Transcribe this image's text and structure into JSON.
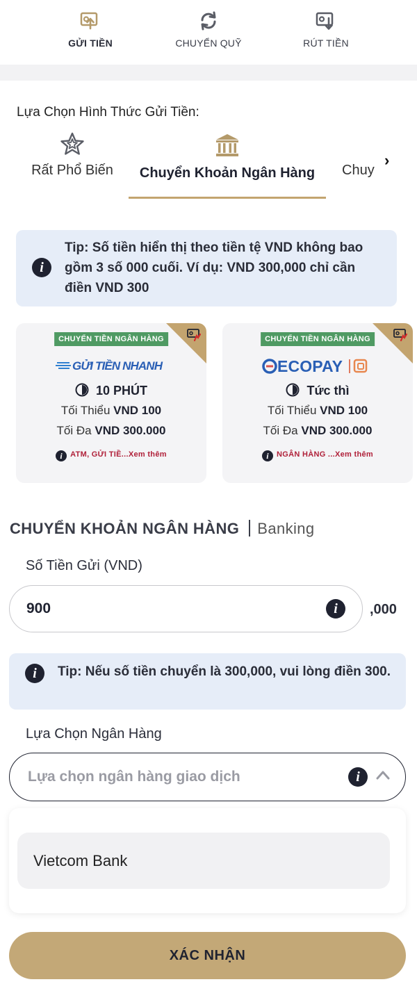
{
  "top_tabs": [
    {
      "label": "GỬI TIỀN",
      "icon": "deposit-icon",
      "active": true
    },
    {
      "label": "CHUYỂN QUỸ",
      "icon": "transfer-icon",
      "active": false
    },
    {
      "label": "RÚT TIỀN",
      "icon": "withdraw-icon",
      "active": false
    }
  ],
  "method_section": {
    "title": "Lựa Chọn Hình Thức Gửi Tiền:",
    "methods": [
      {
        "label": "Rất Phổ Biến",
        "icon": "star-icon",
        "active": false
      },
      {
        "label": "Chuyển Khoản Ngân Hàng",
        "icon": "bank-icon",
        "active": true
      },
      {
        "label": "Chuy",
        "icon": "",
        "active": false
      }
    ],
    "scroll_arrow": "›"
  },
  "tip1": "Tip: Số tiền hiển thị theo tiền tệ VND không bao gồm 3 số 000 cuối. Ví dụ: VND 300,000 chỉ cần điền VND 300",
  "cards": [
    {
      "badge": "CHUYỂN TIỀN NGÂN HÀNG",
      "logo_text": "GỬI TIỀN NHANH",
      "time": "10 PHÚT",
      "min_label": "Tối Thiểu",
      "min_value": "VND 100",
      "max_label": "Tối Đa",
      "max_value": "VND 300.000",
      "more_text": "ATM, GỬI TIỀ...Xem thêm"
    },
    {
      "badge": "CHUYỂN TIỀN NGÂN HÀNG",
      "logo_text": "ECOPAY",
      "time": "Tức thì",
      "min_label": "Tối Thiểu",
      "min_value": "VND 100",
      "max_label": "Tối Đa",
      "max_value": "VND 300.000",
      "more_text": "NGÂN HÀNG ...Xem thêm"
    }
  ],
  "form": {
    "heading_main": "CHUYỂN KHOẢN NGÂN HÀNG",
    "heading_sub": "Banking",
    "amount_label": "Số Tiền Gửi (VND)",
    "amount_value": "900",
    "amount_suffix": ",000",
    "tip2": "Tip: Nếu số tiền chuyển là 300,000, vui lòng điền 300.",
    "bank_label": "Lựa Chọn Ngân Hàng",
    "bank_placeholder": "Lựa chọn ngân hàng giao dịch",
    "bank_options": [
      "Vietcom Bank"
    ],
    "confirm_label": "XÁC NHẬN"
  },
  "colors": {
    "accent_gold": "#c3a46f",
    "confirm_bg": "#c3a877",
    "tip_bg": "#e6edf8",
    "badge_green": "#4f9a63",
    "link_red": "#b0213a",
    "dark": "#1f2230"
  }
}
